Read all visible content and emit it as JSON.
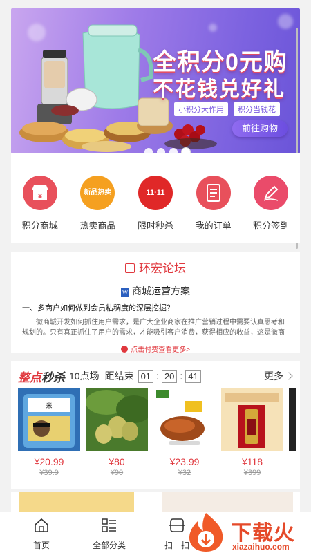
{
  "banner": {
    "headline_line1": "全积分0元购",
    "headline_line2": "不花钱兑好礼",
    "pill1": "小积分大作用",
    "pill2": "积分当钱花",
    "cta": "前往购物",
    "slide_count": 4,
    "active_slide": 4
  },
  "quicknav": {
    "items": [
      {
        "label": "积分商城",
        "icon": "store-icon",
        "color": "#e8505b",
        "glyph": "¥"
      },
      {
        "label": "热卖商品",
        "icon": "hot-tag-icon",
        "color": "#f5a020",
        "glyph": "新品热卖"
      },
      {
        "label": "限时秒杀",
        "icon": "double11-icon",
        "color": "#e02828",
        "glyph": "11·11"
      },
      {
        "label": "我的订单",
        "icon": "order-icon",
        "color": "#e8505b",
        "glyph": "≡"
      },
      {
        "label": "积分签到",
        "icon": "sign-in-icon",
        "color": "#ea4b6a",
        "glyph": "✎"
      }
    ]
  },
  "forum": {
    "title": "环宏论坛",
    "doc_title": "商城运营方案",
    "question": "一、多商户如何做到会员粘稠度的深层挖掘？",
    "body": "微商城开发如何抓住用户需求，是广大企业商家在推广营销过程中需要认真思考和规划的。只有真正抓住了用户的需求，才能吸引客户消费，获得相应的收益，这是微商城运营的关键。",
    "more": "点击付费查看更多>"
  },
  "flash": {
    "title_a": "整点",
    "title_b": "秒杀",
    "session": "10点场",
    "ends_in": "距结束",
    "hh": "01",
    "mm": "20",
    "ss": "41",
    "more": "更多",
    "products": [
      {
        "name": "rice-bag",
        "price": "¥20.99",
        "old": "¥39.9"
      },
      {
        "name": "pears",
        "price": "¥80",
        "old": "¥90"
      },
      {
        "name": "roast-duck",
        "price": "¥23.99",
        "old": "¥32"
      },
      {
        "name": "liquor-box",
        "price": "¥118",
        "old": "¥399"
      }
    ]
  },
  "tabbar": {
    "tabs": [
      {
        "label": "首页",
        "icon": "home-icon"
      },
      {
        "label": "全部分类",
        "icon": "category-icon"
      },
      {
        "label": "扫一扫",
        "icon": "scan-icon"
      }
    ]
  },
  "watermark": {
    "text": "下载火",
    "url": "xiazaihuo.com"
  }
}
